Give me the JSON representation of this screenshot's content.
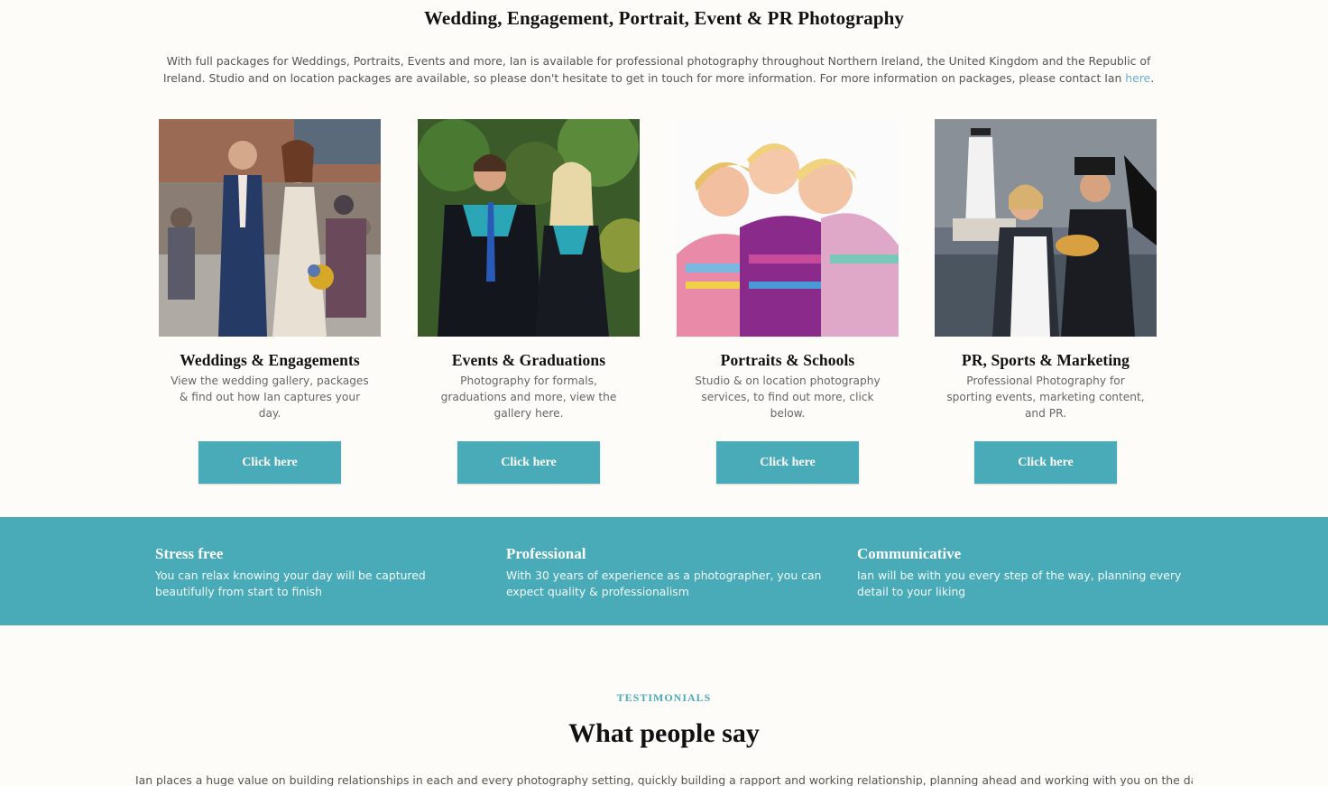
{
  "intro": {
    "title": "Wedding, Engagement, Portrait, Event & PR Photography",
    "text": "With full packages for Weddings, Portraits, Events and more, Ian is available for professional photography throughout Northern Ireland, the United Kingdom and the Republic of Ireland. Studio and on location packages are available, so please don't hesitate to get in touch for more information. For more information on packages, please contact Ian ",
    "link_label": "here",
    "text_end": "."
  },
  "cards": [
    {
      "title": "Weddings & Engagements",
      "desc": "View the wedding gallery, packages & find out how Ian captures your day.",
      "button": "Click here",
      "photo_icon": "wedding-couple-photo"
    },
    {
      "title": "Events & Graduations",
      "desc": "Photography for formals, graduations and more, view the gallery here.",
      "button": "Click here",
      "photo_icon": "graduation-photo"
    },
    {
      "title": "Portraits & Schools",
      "desc": "Studio & on location photography services, to find out more, click below.",
      "button": "Click here",
      "photo_icon": "children-portrait-photo"
    },
    {
      "title": "PR, Sports & Marketing",
      "desc": "Professional Photography for sporting events, marketing content, and PR.",
      "button": "Click here",
      "photo_icon": "pr-marketing-photo"
    }
  ],
  "features": [
    {
      "title": "Stress free",
      "text": "You can relax knowing your day will be captured beautifully from start to finish"
    },
    {
      "title": "Professional",
      "text": "With 30 years of experience as a photographer, you can expect quality & professionalism"
    },
    {
      "title": "Communicative",
      "text": "Ian will be with you every step of the way, planning every detail to your liking"
    }
  ],
  "testimonials": {
    "label": "TESTIMONIALS",
    "title": "What people say",
    "text": "Ian places a huge value on building relationships in each and every photography setting, quickly building a rapport and working relationship, planning ahead and working with you on the day in a relaxed"
  },
  "colors": {
    "accent": "#4aabb8",
    "link": "#6aaed0",
    "background": "#fdfcf8"
  }
}
